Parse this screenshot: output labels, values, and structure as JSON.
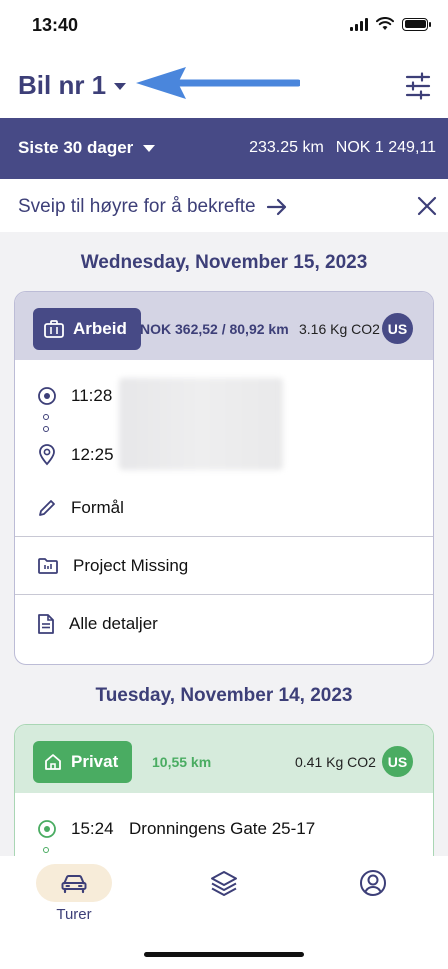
{
  "status_bar": {
    "time": "13:40"
  },
  "header": {
    "vehicle": "Bil nr 1",
    "filter_icon": "sliders-icon",
    "annotation": "blue-arrow"
  },
  "period": {
    "label": "Siste 30 dager",
    "distance": "233.25 km",
    "amount": "NOK 1 249,11"
  },
  "banner": {
    "text": "Sveip til høyre for å bekrefte",
    "arrow_icon": "arrow-right-icon",
    "close_icon": "close-icon"
  },
  "days": [
    {
      "date": "Wednesday, November 15, 2023",
      "trip": {
        "type": "Arbeid",
        "amount": "NOK 362,52 / 80,92 km",
        "co2": "3.16 Kg CO2",
        "avatar": "US",
        "start_time": "11:28",
        "end_time": "12:25",
        "purpose": "Formål",
        "project": "Project Missing",
        "details": "Alle detaljer",
        "colors": {
          "head": "#d4d4e4",
          "badge": "#474a86",
          "avatar": "#474a86",
          "border": "#bcbcd6"
        }
      }
    },
    {
      "date": "Tuesday, November 14, 2023",
      "trip": {
        "type": "Privat",
        "distance": "10,55 km",
        "co2": "0.41 Kg CO2",
        "avatar": "US",
        "start_time": "15:24",
        "start_address": "Dronningens Gate 25-17",
        "colors": {
          "head": "#d6ebdc",
          "badge": "#4aac62",
          "avatar": "#4aac62",
          "border": "#a9d6b4"
        }
      }
    }
  ],
  "tabs": [
    {
      "label": "Turer",
      "icon": "car-icon",
      "active": true
    },
    {
      "label": "",
      "icon": "layers-icon",
      "active": false
    },
    {
      "label": "",
      "icon": "profile-icon",
      "active": false
    }
  ],
  "colors": {
    "primary": "#474a86",
    "accent_green": "#4aac62",
    "tab_active_bg": "#f7ecd9"
  }
}
